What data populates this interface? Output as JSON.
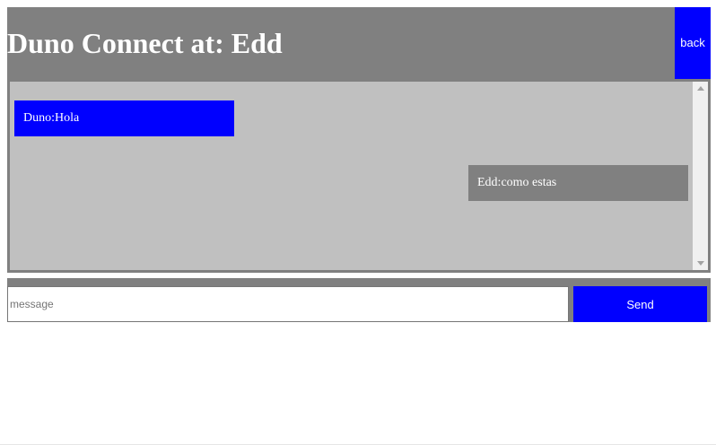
{
  "header": {
    "title": "Duno Connect at: Edd",
    "back_label": "back"
  },
  "chat": {
    "messages": [
      {
        "text": "Duno:Hola",
        "sender": "self",
        "color": "#0000ff"
      },
      {
        "text": "Edd:como estas",
        "sender": "other",
        "color": "#808080"
      }
    ]
  },
  "composer": {
    "placeholder": "message",
    "value": "",
    "send_label": "Send"
  },
  "colors": {
    "accent": "#0000ff",
    "panel": "#808080",
    "chat_background": "#c0c0c0"
  }
}
